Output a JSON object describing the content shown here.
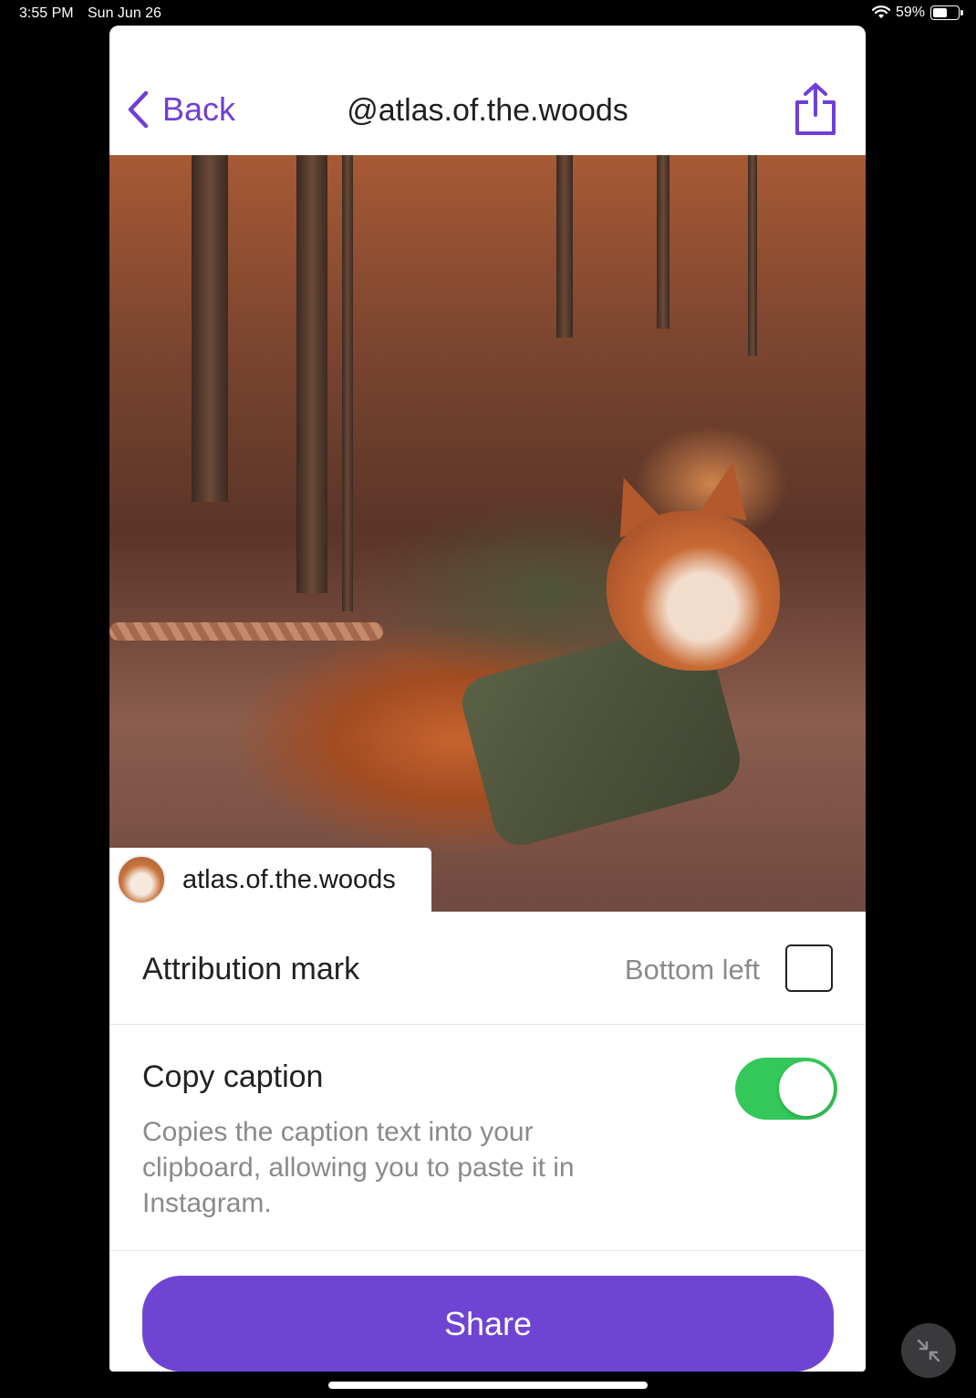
{
  "status_bar": {
    "time": "3:55 PM",
    "date": "Sun Jun 26",
    "battery_text": "59%",
    "battery_level": 0.59
  },
  "nav": {
    "back_label": "Back",
    "title": "@atlas.of.the.woods",
    "back_icon": "chevron-left-icon",
    "share_icon": "share-icon"
  },
  "photo": {
    "attribution_name": "atlas.of.the.woods"
  },
  "settings": {
    "attribution_mark": {
      "label": "Attribution mark",
      "value": "Bottom left",
      "checked": false
    },
    "copy_caption": {
      "label": "Copy caption",
      "description": "Copies the caption text into your clipboard, allowing you to paste it in Instagram.",
      "enabled": true
    }
  },
  "actions": {
    "share_label": "Share"
  },
  "colors": {
    "accent": "#6f44d2",
    "toggle_on": "#34c759"
  }
}
